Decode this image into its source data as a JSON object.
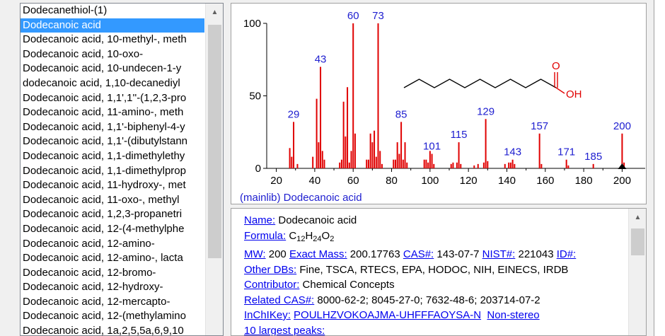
{
  "compound_list": {
    "selected_index": 1,
    "items": [
      "Dodecanethiol-(1)",
      "Dodecanoic acid",
      "Dodecanoic acid, 10-methyl-, meth",
      "Dodecanoic acid, 10-oxo-",
      "Dodecanoic acid, 10-undecen-1-y",
      "dodecanoic acid, 1,10-decanediyl",
      "Dodecanoic acid, 1,1',1''-(1,2,3-pro",
      "Dodecanoic acid, 11-amino-, meth",
      "Dodecanoic acid, 1,1'-biphenyl-4-y",
      "Dodecanoic acid, 1,1'-(dibutylstann",
      "Dodecanoic acid, 1,1-dimethylethy",
      "Dodecanoic acid, 1,1-dimethylprop",
      "Dodecanoic acid, 11-hydroxy-, met",
      "Dodecanoic acid, 11-oxo-, methyl",
      "Dodecanoic acid, 1,2,3-propanetri",
      "Dodecanoic acid, 12-(4-methylphe",
      "Dodecanoic acid, 12-amino-",
      "Dodecanoic acid, 12-amino-, lacta",
      "Dodecanoic acid, 12-bromo-",
      "Dodecanoic acid, 12-hydroxy-",
      "Dodecanoic acid, 12-mercapto-",
      "Dodecanoic acid, 12-(methylamino",
      "Dodecanoic acid, 1a,2,5,5a,6,9,10"
    ]
  },
  "spectrum": {
    "caption": "(mainlib) Dodecanoic acid",
    "structure_labels": {
      "o": "O",
      "oh": "OH"
    },
    "peak_color": "#e00000",
    "label_color": "#2020d0"
  },
  "chart_data": {
    "type": "bar",
    "title": "",
    "xlabel": "",
    "ylabel": "",
    "xlim": [
      15,
      212
    ],
    "ylim": [
      0,
      100
    ],
    "xticks": [
      20,
      30,
      40,
      50,
      60,
      70,
      80,
      90,
      100,
      110,
      120,
      130,
      140,
      150,
      160,
      170,
      180,
      190,
      200
    ],
    "xtick_labels": [
      "20",
      "40",
      "60",
      "80",
      "100",
      "120",
      "140",
      "160",
      "180",
      "200"
    ],
    "yticks": [
      0,
      50,
      100
    ],
    "ytick_labels": [
      "0",
      "50",
      "100"
    ],
    "peaks": [
      [
        27,
        14
      ],
      [
        28,
        8
      ],
      [
        29,
        32
      ],
      [
        31,
        3
      ],
      [
        39,
        8
      ],
      [
        41,
        48
      ],
      [
        42,
        18
      ],
      [
        43,
        70
      ],
      [
        44,
        12
      ],
      [
        45,
        6
      ],
      [
        53,
        4
      ],
      [
        54,
        6
      ],
      [
        55,
        46
      ],
      [
        56,
        22
      ],
      [
        57,
        56
      ],
      [
        58,
        4
      ],
      [
        59,
        12
      ],
      [
        60,
        100
      ],
      [
        61,
        24
      ],
      [
        67,
        6
      ],
      [
        68,
        6
      ],
      [
        69,
        24
      ],
      [
        70,
        18
      ],
      [
        71,
        26
      ],
      [
        72,
        8
      ],
      [
        73,
        100
      ],
      [
        74,
        12
      ],
      [
        75,
        3
      ],
      [
        81,
        6
      ],
      [
        82,
        6
      ],
      [
        83,
        18
      ],
      [
        84,
        10
      ],
      [
        85,
        32
      ],
      [
        86,
        6
      ],
      [
        87,
        18
      ],
      [
        88,
        4
      ],
      [
        97,
        6
      ],
      [
        98,
        6
      ],
      [
        99,
        4
      ],
      [
        100,
        12
      ],
      [
        101,
        10
      ],
      [
        102,
        3
      ],
      [
        111,
        3
      ],
      [
        112,
        4
      ],
      [
        114,
        4
      ],
      [
        115,
        18
      ],
      [
        116,
        3
      ],
      [
        123,
        2
      ],
      [
        125,
        3
      ],
      [
        128,
        4
      ],
      [
        129,
        34
      ],
      [
        130,
        5
      ],
      [
        139,
        3
      ],
      [
        141,
        4
      ],
      [
        142,
        4
      ],
      [
        143,
        6
      ],
      [
        144,
        3
      ],
      [
        157,
        24
      ],
      [
        158,
        3
      ],
      [
        171,
        6
      ],
      [
        172,
        2
      ],
      [
        185,
        3
      ],
      [
        200,
        24
      ],
      [
        201,
        4
      ]
    ],
    "peak_labels": [
      {
        "x": 29,
        "label": "29"
      },
      {
        "x": 43,
        "label": "43"
      },
      {
        "x": 60,
        "label": "60"
      },
      {
        "x": 73,
        "label": "73"
      },
      {
        "x": 85,
        "label": "85"
      },
      {
        "x": 101,
        "label": "101"
      },
      {
        "x": 115,
        "label": "115"
      },
      {
        "x": 129,
        "label": "129"
      },
      {
        "x": 143,
        "label": "143"
      },
      {
        "x": 157,
        "label": "157"
      },
      {
        "x": 171,
        "label": "171"
      },
      {
        "x": 185,
        "label": "185"
      },
      {
        "x": 200,
        "label": "200"
      }
    ],
    "molecular_ion_marker_x": 200
  },
  "info": {
    "name_label": "Name:",
    "name_value": "Dodecanoic acid",
    "formula_label": "Formula:",
    "formula": {
      "c": "C",
      "c_n": "12",
      "h": "H",
      "h_n": "24",
      "o": "O",
      "o_n": "2"
    },
    "mw_label": "MW:",
    "mw_value": "200",
    "exact_mass_label": "Exact Mass:",
    "exact_mass_value": "200.17763",
    "cas_label": "CAS#:",
    "cas_value": "143-07-7",
    "nist_label": "NIST#:",
    "nist_value": "221043",
    "id_label": "ID#:",
    "other_dbs_label": "Other DBs:",
    "other_dbs_value": "Fine, TSCA, RTECS, EPA, HODOC, NIH, EINECS, IRDB",
    "contributor_label": "Contributor:",
    "contributor_value": "Chemical Concepts",
    "related_cas_label": "Related CAS#:",
    "related_cas_value": "8000-62-2; 8045-27-0; 7632-48-6; 203714-07-2",
    "inchikey_label": "InChIKey:",
    "inchikey_value": "POULHZVOKOAJMA-UHFFFAOYSA-N",
    "non_stereo_label": "Non-stereo",
    "largest_peaks_label": "10 largest peaks:"
  }
}
